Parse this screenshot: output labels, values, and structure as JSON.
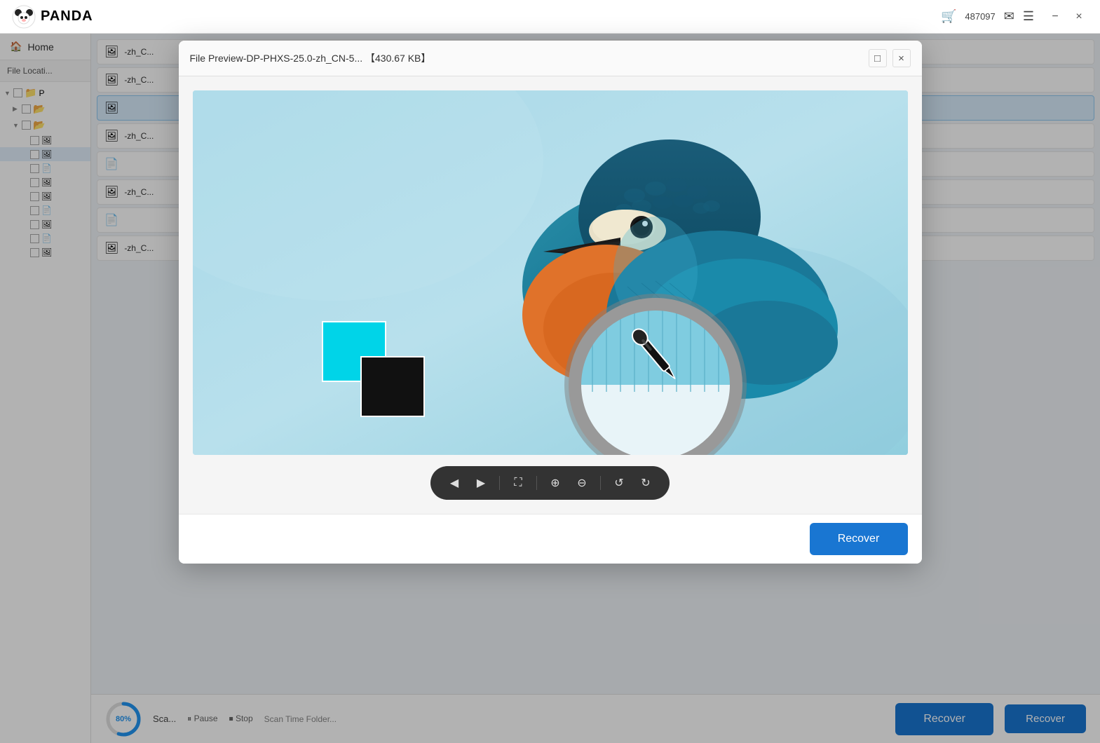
{
  "app": {
    "title": "PANDА",
    "user_id": "487097"
  },
  "titlebar": {
    "minimize_label": "−",
    "close_label": "×"
  },
  "sidebar": {
    "home_label": "Home",
    "file_location_label": "File Locati...",
    "tree_items": [
      {
        "id": "folder1",
        "type": "folder",
        "expanded": true,
        "label": "P...",
        "indent": 0
      },
      {
        "id": "folder2",
        "type": "folder",
        "expanded": false,
        "label": "...",
        "indent": 1
      },
      {
        "id": "folder3",
        "type": "folder",
        "expanded": true,
        "label": "...",
        "indent": 1
      },
      {
        "id": "file1",
        "type": "file",
        "label": "...",
        "indent": 2
      },
      {
        "id": "file2",
        "type": "file",
        "label": "...",
        "indent": 2,
        "highlighted": true
      },
      {
        "id": "file3",
        "type": "file",
        "label": "...",
        "indent": 2
      },
      {
        "id": "file4",
        "type": "file",
        "label": "...",
        "indent": 2
      },
      {
        "id": "file5",
        "type": "file",
        "label": "...",
        "indent": 2
      },
      {
        "id": "file6",
        "type": "file",
        "label": "...",
        "indent": 2
      },
      {
        "id": "file7",
        "type": "file",
        "label": "...",
        "indent": 2
      },
      {
        "id": "file8",
        "type": "file",
        "label": "...",
        "indent": 2
      },
      {
        "id": "file9",
        "type": "file",
        "label": "...",
        "indent": 2
      }
    ]
  },
  "file_list": {
    "items": [
      {
        "name": "-zh_C...",
        "active": false
      },
      {
        "name": "-zh_C...",
        "active": false
      },
      {
        "name": "",
        "active": true
      },
      {
        "name": "-zh_C...",
        "active": false
      },
      {
        "name": "",
        "active": false
      },
      {
        "name": "-zh_C...",
        "active": false
      },
      {
        "name": "",
        "active": false
      },
      {
        "name": "-zh_C...",
        "active": false
      }
    ]
  },
  "modal": {
    "title": "File Preview-DP-PHXS-25.0-zh_CN-5...  【430.67 KB】",
    "maximize_label": "□",
    "close_label": "×"
  },
  "image_toolbar": {
    "prev_label": "◀",
    "next_label": "▶",
    "fullscreen_label": "⛶",
    "zoom_in_label": "⊕",
    "zoom_out_label": "⊖",
    "rotate_left_label": "↺",
    "rotate_right_label": "↻"
  },
  "bottom_bar": {
    "progress_percent": "80%",
    "scan_label": "Sca...",
    "pause_label": "⏸ Pause",
    "stop_label": "⏹ Stop",
    "scan_path_label": "Scan Time Folder...",
    "recover_main_label": "Recover",
    "recover_secondary_label": "Recover"
  },
  "colors": {
    "accent_blue": "#1976d2",
    "progress_blue": "#2196f3",
    "highlight_bg": "#e3f0fc",
    "cyan_swatch": "#00d4e8",
    "black_swatch": "#111111"
  }
}
